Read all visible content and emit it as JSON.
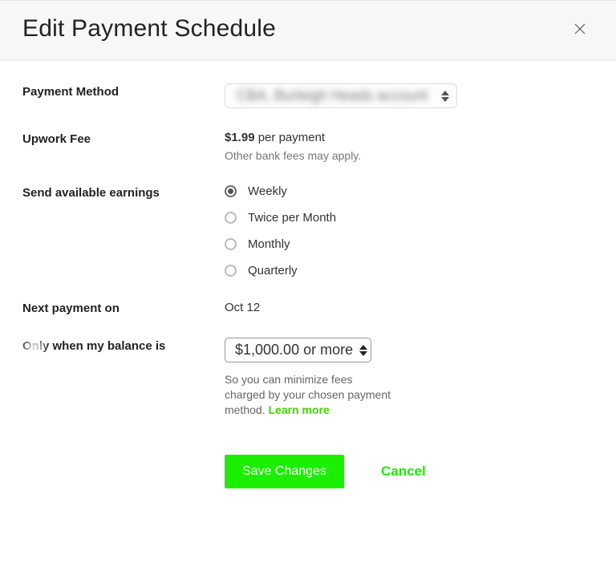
{
  "header": {
    "title": "Edit Payment Schedule"
  },
  "payment_method": {
    "label": "Payment Method",
    "selected": "CBA, Burleigh Heads account"
  },
  "fee": {
    "label": "Upwork Fee",
    "amount": "$1.99",
    "per": "per payment",
    "note": "Other bank fees may apply."
  },
  "schedule": {
    "label": "Send available earnings",
    "options": {
      "0": {
        "label": "Weekly",
        "selected": true
      },
      "1": {
        "label": "Twice per Month",
        "selected": false
      },
      "2": {
        "label": "Monthly",
        "selected": false
      },
      "3": {
        "label": "Quarterly",
        "selected": false
      }
    }
  },
  "next_payment": {
    "label": "Next payment on",
    "value": "Oct 12"
  },
  "balance": {
    "label": "Only when my balance is",
    "selected": "$1,000.00 or more",
    "hint_prefix": "So you can minimize fees charged by your chosen payment method. ",
    "learn_more": "Learn more"
  },
  "actions": {
    "save": "Save Changes",
    "cancel": "Cancel"
  }
}
